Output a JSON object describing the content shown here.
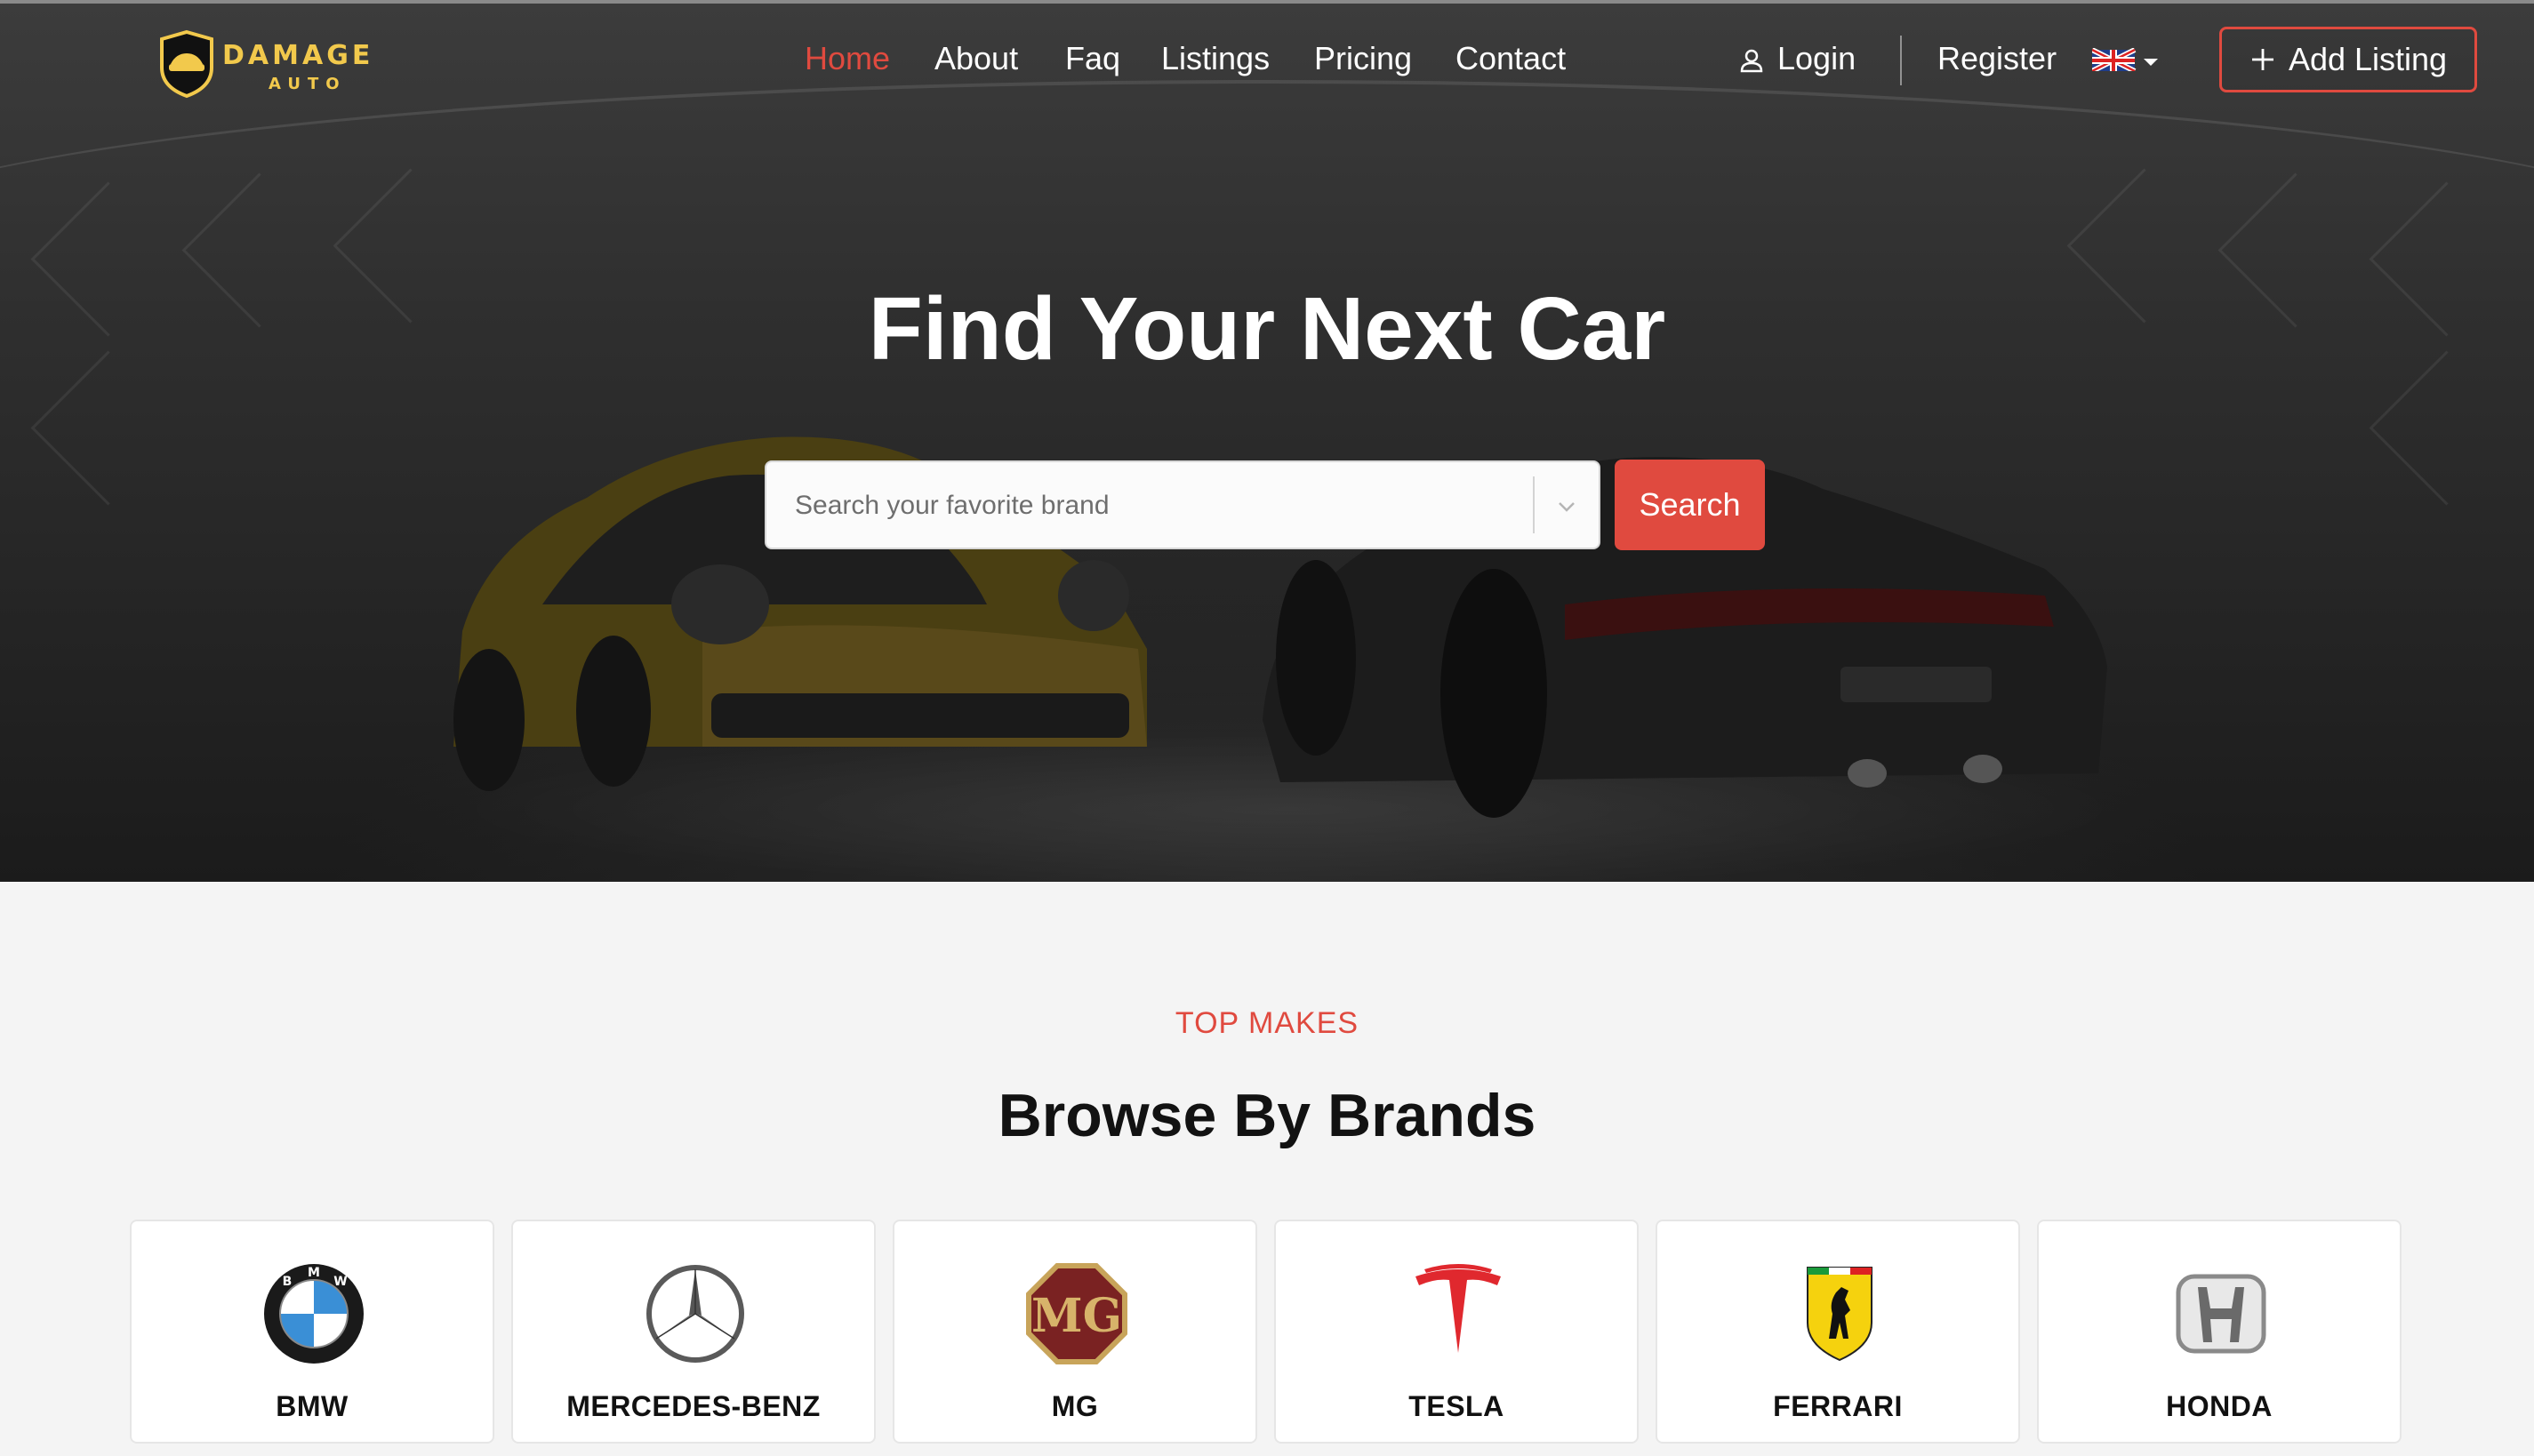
{
  "brand": {
    "logo_text_top": "DAMAGE",
    "logo_text_bottom": "AUTO",
    "accent_color": "#e04a3f",
    "logo_gold": "#f2c94c"
  },
  "nav": {
    "items": [
      {
        "label": "Home",
        "active": true
      },
      {
        "label": "About"
      },
      {
        "label": "Faq"
      },
      {
        "label": "Listings"
      },
      {
        "label": "Pricing"
      },
      {
        "label": "Contact"
      }
    ],
    "login_label": "Login",
    "register_label": "Register",
    "language_icon": "uk-flag-icon",
    "add_listing_label": "Add Listing"
  },
  "hero": {
    "title": "Find Your Next Car",
    "search_placeholder": "Search your favorite brand",
    "search_button_label": "Search"
  },
  "brands_section": {
    "eyebrow": "TOP MAKES",
    "title": "Browse By Brands",
    "brands": [
      {
        "name": "BMW",
        "icon": "bmw-logo-icon"
      },
      {
        "name": "MERCEDES-BENZ",
        "icon": "mercedes-logo-icon"
      },
      {
        "name": "MG",
        "icon": "mg-logo-icon"
      },
      {
        "name": "TESLA",
        "icon": "tesla-logo-icon"
      },
      {
        "name": "FERRARI",
        "icon": "ferrari-logo-icon"
      },
      {
        "name": "HONDA",
        "icon": "honda-logo-icon"
      }
    ]
  }
}
